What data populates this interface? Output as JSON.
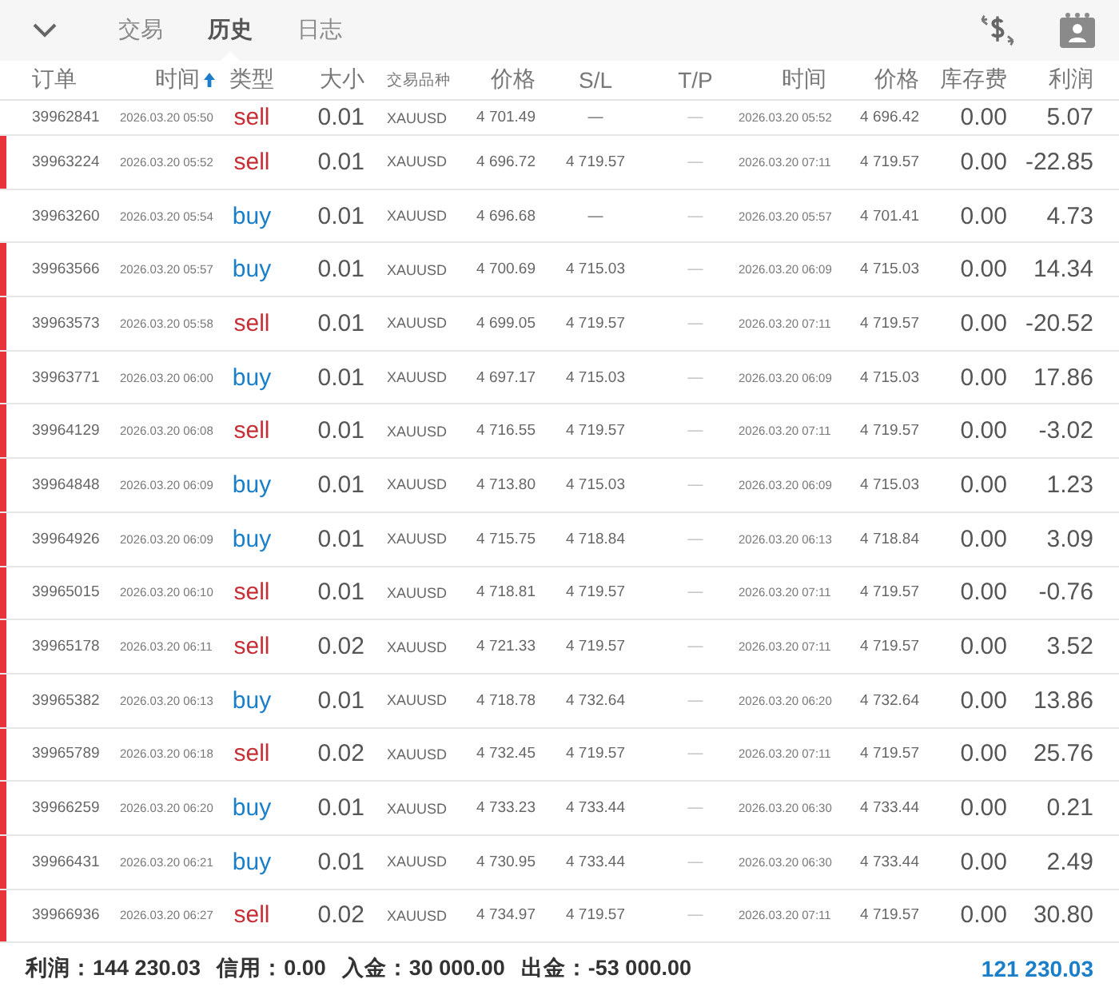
{
  "tabs": [
    {
      "label": "交易",
      "selected": false
    },
    {
      "label": "历史",
      "selected": true
    },
    {
      "label": "日志",
      "selected": false
    }
  ],
  "columns": [
    {
      "label": "订单",
      "sorted": false
    },
    {
      "label": "时间",
      "sorted": true
    },
    {
      "label": "类型",
      "sorted": false
    },
    {
      "label": "大小",
      "sorted": false
    },
    {
      "label": "交易品种",
      "sorted": false
    },
    {
      "label": "价格",
      "sorted": false
    },
    {
      "label": "S/L",
      "sorted": false
    },
    {
      "label": "T/P",
      "sorted": false
    },
    {
      "label": "时间",
      "sorted": false
    },
    {
      "label": "价格",
      "sorted": false
    },
    {
      "label": "库存费",
      "sorted": false
    },
    {
      "label": "利润",
      "sorted": false
    }
  ],
  "rows": [
    {
      "order": "39962841",
      "open_time": "2026.03.20 05:50",
      "type": "sell",
      "color": "#c62f35",
      "size": "0.01",
      "symbol": "XAUUSD",
      "open_price": "4 701.49",
      "sl": "—",
      "tp": "—",
      "close_time": "2026.03.20 05:52",
      "close_price": "4 696.42",
      "swap": "0.00",
      "profit": "5.07",
      "marked": false
    },
    {
      "order": "39963224",
      "open_time": "2026.03.20 05:52",
      "type": "sell",
      "color": "#c62f35",
      "size": "0.01",
      "symbol": "XAUUSD",
      "open_price": "4 696.72",
      "sl": "4 719.57",
      "tp": "—",
      "close_time": "2026.03.20 07:11",
      "close_price": "4 719.57",
      "swap": "0.00",
      "profit": "-22.85",
      "marked": true
    },
    {
      "order": "39963260",
      "open_time": "2026.03.20 05:54",
      "type": "buy",
      "color": "#1a7fc8",
      "size": "0.01",
      "symbol": "XAUUSD",
      "open_price": "4 696.68",
      "sl": "—",
      "tp": "—",
      "close_time": "2026.03.20 05:57",
      "close_price": "4 701.41",
      "swap": "0.00",
      "profit": "4.73",
      "marked": false
    },
    {
      "order": "39963566",
      "open_time": "2026.03.20 05:57",
      "type": "buy",
      "color": "#1a7fc8",
      "size": "0.01",
      "symbol": "XAUUSD",
      "open_price": "4 700.69",
      "sl": "4 715.03",
      "tp": "—",
      "close_time": "2026.03.20 06:09",
      "close_price": "4 715.03",
      "swap": "0.00",
      "profit": "14.34",
      "marked": true
    },
    {
      "order": "39963573",
      "open_time": "2026.03.20 05:58",
      "type": "sell",
      "color": "#c62f35",
      "size": "0.01",
      "symbol": "XAUUSD",
      "open_price": "4 699.05",
      "sl": "4 719.57",
      "tp": "—",
      "close_time": "2026.03.20 07:11",
      "close_price": "4 719.57",
      "swap": "0.00",
      "profit": "-20.52",
      "marked": true
    },
    {
      "order": "39963771",
      "open_time": "2026.03.20 06:00",
      "type": "buy",
      "color": "#1a7fc8",
      "size": "0.01",
      "symbol": "XAUUSD",
      "open_price": "4 697.17",
      "sl": "4 715.03",
      "tp": "—",
      "close_time": "2026.03.20 06:09",
      "close_price": "4 715.03",
      "swap": "0.00",
      "profit": "17.86",
      "marked": true
    },
    {
      "order": "39964129",
      "open_time": "2026.03.20 06:08",
      "type": "sell",
      "color": "#c62f35",
      "size": "0.01",
      "symbol": "XAUUSD",
      "open_price": "4 716.55",
      "sl": "4 719.57",
      "tp": "—",
      "close_time": "2026.03.20 07:11",
      "close_price": "4 719.57",
      "swap": "0.00",
      "profit": "-3.02",
      "marked": true
    },
    {
      "order": "39964848",
      "open_time": "2026.03.20 06:09",
      "type": "buy",
      "color": "#1a7fc8",
      "size": "0.01",
      "symbol": "XAUUSD",
      "open_price": "4 713.80",
      "sl": "4 715.03",
      "tp": "—",
      "close_time": "2026.03.20 06:09",
      "close_price": "4 715.03",
      "swap": "0.00",
      "profit": "1.23",
      "marked": true
    },
    {
      "order": "39964926",
      "open_time": "2026.03.20 06:09",
      "type": "buy",
      "color": "#1a7fc8",
      "size": "0.01",
      "symbol": "XAUUSD",
      "open_price": "4 715.75",
      "sl": "4 718.84",
      "tp": "—",
      "close_time": "2026.03.20 06:13",
      "close_price": "4 718.84",
      "swap": "0.00",
      "profit": "3.09",
      "marked": true
    },
    {
      "order": "39965015",
      "open_time": "2026.03.20 06:10",
      "type": "sell",
      "color": "#c62f35",
      "size": "0.01",
      "symbol": "XAUUSD",
      "open_price": "4 718.81",
      "sl": "4 719.57",
      "tp": "—",
      "close_time": "2026.03.20 07:11",
      "close_price": "4 719.57",
      "swap": "0.00",
      "profit": "-0.76",
      "marked": true
    },
    {
      "order": "39965178",
      "open_time": "2026.03.20 06:11",
      "type": "sell",
      "color": "#c62f35",
      "size": "0.02",
      "symbol": "XAUUSD",
      "open_price": "4 721.33",
      "sl": "4 719.57",
      "tp": "—",
      "close_time": "2026.03.20 07:11",
      "close_price": "4 719.57",
      "swap": "0.00",
      "profit": "3.52",
      "marked": true
    },
    {
      "order": "39965382",
      "open_time": "2026.03.20 06:13",
      "type": "buy",
      "color": "#1a7fc8",
      "size": "0.01",
      "symbol": "XAUUSD",
      "open_price": "4 718.78",
      "sl": "4 732.64",
      "tp": "—",
      "close_time": "2026.03.20 06:20",
      "close_price": "4 732.64",
      "swap": "0.00",
      "profit": "13.86",
      "marked": true
    },
    {
      "order": "39965789",
      "open_time": "2026.03.20 06:18",
      "type": "sell",
      "color": "#c62f35",
      "size": "0.02",
      "symbol": "XAUUSD",
      "open_price": "4 732.45",
      "sl": "4 719.57",
      "tp": "—",
      "close_time": "2026.03.20 07:11",
      "close_price": "4 719.57",
      "swap": "0.00",
      "profit": "25.76",
      "marked": true
    },
    {
      "order": "39966259",
      "open_time": "2026.03.20 06:20",
      "type": "buy",
      "color": "#1a7fc8",
      "size": "0.01",
      "symbol": "XAUUSD",
      "open_price": "4 733.23",
      "sl": "4 733.44",
      "tp": "—",
      "close_time": "2026.03.20 06:30",
      "close_price": "4 733.44",
      "swap": "0.00",
      "profit": "0.21",
      "marked": true
    },
    {
      "order": "39966431",
      "open_time": "2026.03.20 06:21",
      "type": "buy",
      "color": "#1a7fc8",
      "size": "0.01",
      "symbol": "XAUUSD",
      "open_price": "4 730.95",
      "sl": "4 733.44",
      "tp": "—",
      "close_time": "2026.03.20 06:30",
      "close_price": "4 733.44",
      "swap": "0.00",
      "profit": "2.49",
      "marked": true
    },
    {
      "order": "39966936",
      "open_time": "2026.03.20 06:27",
      "type": "sell",
      "color": "#c62f35",
      "size": "0.02",
      "symbol": "XAUUSD",
      "open_price": "4 734.97",
      "sl": "4 719.57",
      "tp": "—",
      "close_time": "2026.03.20 07:11",
      "close_price": "4 719.57",
      "swap": "0.00",
      "profit": "30.80",
      "marked": true
    }
  ],
  "summary": {
    "items": [
      "利润：144 230.03",
      "信用：0.00",
      "入金：30 000.00",
      "出金：-53 000.00"
    ],
    "total": "121 230.03"
  }
}
